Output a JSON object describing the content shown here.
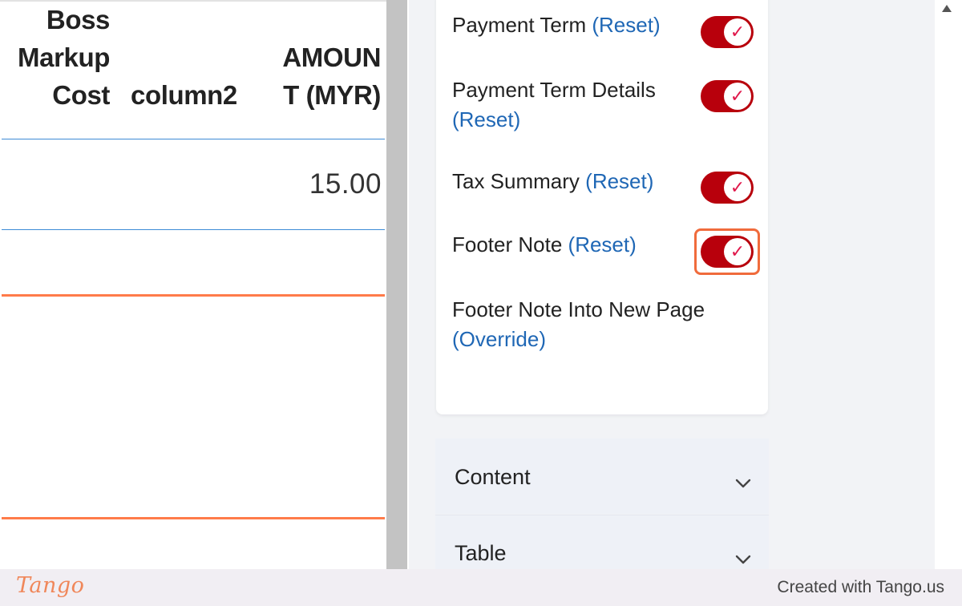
{
  "preview": {
    "columns": {
      "boss_markup_cost": [
        "Boss",
        "Markup",
        "Cost"
      ],
      "column2": "column2",
      "amount": [
        "AMOUN",
        "T (MYR)"
      ]
    },
    "row_amount": "15.00"
  },
  "settings": {
    "items": [
      {
        "label": "Payment Term",
        "action": "(Reset)",
        "toggle_on": true
      },
      {
        "label": "Payment Term Details",
        "action": "(Reset)",
        "toggle_on": true
      },
      {
        "label": "Tax Summary",
        "action": "(Reset)",
        "toggle_on": true
      },
      {
        "label": "Footer Note",
        "action": "(Reset)",
        "toggle_on": true,
        "highlighted": true
      },
      {
        "label": "Footer Note Into New Page",
        "action": "(Override)"
      }
    ],
    "toggle_check_glyph": "✓"
  },
  "accordions": [
    {
      "label": "Content"
    },
    {
      "label": "Table"
    }
  ],
  "footer": {
    "logo": "Tango",
    "credit": "Created with Tango.us"
  },
  "colors": {
    "toggle_on": "#b8000c",
    "link": "#1f67b5",
    "highlight": "#f06b3c",
    "orange_rule": "#ff7b4a",
    "blue_rule": "#3d8bd6"
  },
  "icons": {
    "accordion_chevron": "chevron-down-icon",
    "scroll_up": "scroll-up-arrow-icon",
    "toggle_check": "check-icon"
  }
}
